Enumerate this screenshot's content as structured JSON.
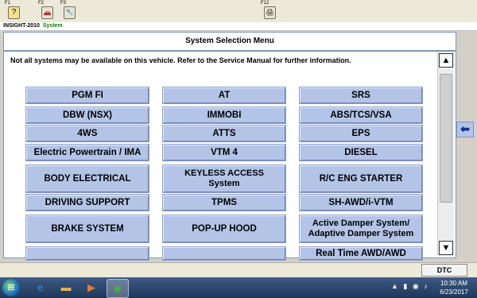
{
  "toolbar": {
    "keys": [
      {
        "label": "F1",
        "icon": "help-icon",
        "glyph": "?"
      },
      {
        "label": "F2",
        "icon": "car-icon",
        "glyph": "🚗"
      },
      {
        "label": "F3",
        "icon": "tools-icon",
        "glyph": "🔧"
      },
      {
        "label": "F12",
        "icon": "print-icon",
        "glyph": "🖨"
      }
    ]
  },
  "breadcrumb": {
    "vehicle": "INSIGHT-2010",
    "section": "System"
  },
  "panel": {
    "title": "System Selection Menu",
    "notice": "Not all systems may be available on this vehicle. Refer to the Service Manual for further information."
  },
  "systems": [
    [
      "PGM FI",
      "AT",
      "SRS"
    ],
    [
      "DBW (NSX)",
      "IMMOBI",
      "ABS/TCS/VSA"
    ],
    [
      "4WS",
      "ATTS",
      "EPS"
    ],
    [
      "Electric Powertrain / IMA",
      "VTM 4",
      "DIESEL"
    ],
    [
      "BODY ELECTRICAL",
      "KEYLESS ACCESS\nSystem",
      "R/C ENG STARTER"
    ],
    [
      "DRIVING SUPPORT",
      "TPMS",
      "SH-AWD/i-VTM"
    ],
    [
      "BRAKE SYSTEM",
      "POP-UP HOOD",
      "Active Damper System/\nAdaptive Damper System"
    ],
    [
      "",
      "",
      "Real Time AWD/AWD"
    ]
  ],
  "scroll": {
    "up": "▲",
    "down": "▼"
  },
  "side": {
    "back_glyph": "⬅"
  },
  "status": {
    "dtc": "DTC"
  },
  "taskbar": {
    "start_glyph": "⊞",
    "apps": [
      {
        "icon": "ie-icon",
        "glyph": "e",
        "color": "#2a8ad8"
      },
      {
        "icon": "folder-icon",
        "glyph": "▬",
        "color": "#e2b447"
      },
      {
        "icon": "media-player-icon",
        "glyph": "▶",
        "color": "#e07a2a"
      },
      {
        "icon": "hds-app-icon",
        "glyph": "◆",
        "color": "#4fa84a"
      }
    ],
    "time": "10:30 AM",
    "date": "6/23/2017"
  },
  "colors": {
    "button": "#b3c4e7",
    "border": "#7a9ab8"
  }
}
